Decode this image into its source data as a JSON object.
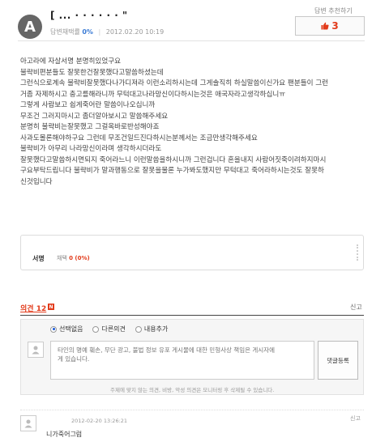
{
  "header": {
    "avatar_letter": "A",
    "user_name": "[ ...  ·  · · ·  · ·  \"",
    "adopt_rate_label": "답변채택률",
    "adopt_rate_value": "0%",
    "post_datetime": "2012.02.20 10:19",
    "like_label": "답변 추천하기",
    "like_count": "3"
  },
  "body_lines": [
    "아고라에 자살서명 분명히있었구요",
    "불략비편분들도 잘못한건잘못했다고말씀하셨는데",
    "그런식으로계속 불략비잘못했다나가디져라 이런소리하시는데 그게솔직히 하실말씀이신가요 팬분들이 그런",
    "거좀 자제하시고 충고를해라니까 무턱대고나라망신이다하시는것은 애국자라고생각하십니ㅠ",
    "그렇게 사람보고 쉽게죽어란 말씀이나오십니까",
    "무조건 그러지마시고 좀더알아보시고 말씀해주세요",
    "분명히 불략비는잘못했고 그걸옥바로반성해야죠",
    "사과도몰론해야하구요 그런데 무조건일드진다하시는분께서는 조금만생각해주세요",
    "불략비가 아무리 나라망신이라며 생각하시더라도",
    "잘못했다고말씀하시면되지 죽어라느니 이런말씀을하시니까 그런겁니다 혼을내지 사람어짓죽이려하지마시",
    "구요부탁드립니다 불략비가 말과행동으로 잘못을물론 누가봐도했지만 무턱대고 죽어라하시는것도 잘못하",
    "신것입니다"
  ],
  "signature": {
    "label": "서명",
    "adopt_label": "채택",
    "adopt_value": "0 (0%)"
  },
  "comments": {
    "title": "의견 12",
    "new_badge": "N",
    "report_label": "신고",
    "form": {
      "options": [
        "선택없음",
        "다른의견",
        "내용추가"
      ],
      "selected_option": "선택없음",
      "placeholder": "타인의 명예 훼손, 무단 광고, 불법 정보 유포 게시물에 대한 민형사상 책임은 게시자에\n게 있습니다.",
      "submit_label": "댓글등록",
      "note": "주제에 맞지 않는 의견, 비방, 악성 의견은 모니터링 후 삭제될 수 있습니다."
    },
    "items": [
      {
        "datetime": "2012-02-20 13:26:21",
        "text": "니가죽어그럼",
        "report_label": "신고"
      }
    ]
  }
}
